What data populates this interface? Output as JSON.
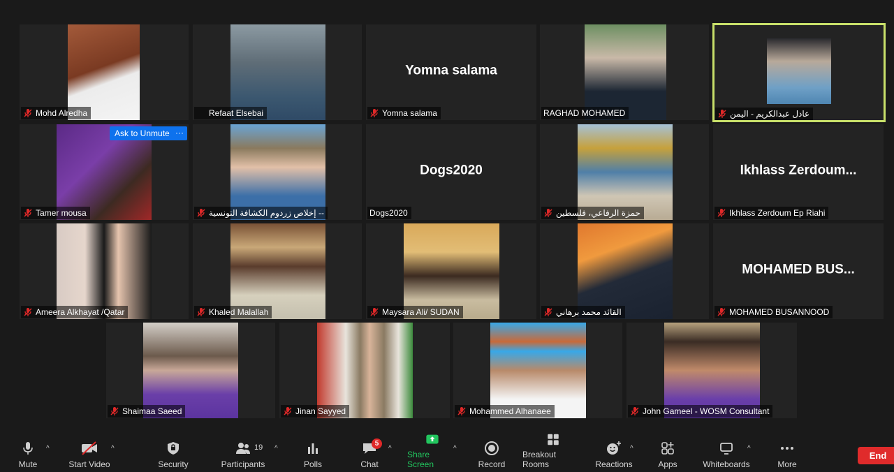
{
  "participants": [
    {
      "name": "Mohd Alredha",
      "bg": "#a35a3a",
      "fg": "#f0f0f0"
    },
    {
      "name": "Refaat Elsebai",
      "bg": "#6f7d86",
      "fg": "#3c5870"
    },
    {
      "name": "Yomna salama",
      "display": "Yomna salama"
    },
    {
      "name": "RAGHAD MOHAMED",
      "bg": "#6d8f62",
      "fg": "#1c2633"
    },
    {
      "name": "عادل عبدالكريم - اليمن",
      "bg": "#2a2a2e",
      "fg": "#6fa0c6"
    },
    {
      "name": "Tamer mousa",
      "bg": "#5b2a86",
      "fg": "#3d2a22"
    },
    {
      "name": "إخلاص زردوم الكشافة التونسية --",
      "bg": "#6aa4d4",
      "fg": "#3c6fa8"
    },
    {
      "name": "Dogs2020",
      "display": "Dogs2020"
    },
    {
      "name": "حمزة الرفاعي، فلسطين",
      "bg": "#a6c1d6",
      "fg": "#c6a13c"
    },
    {
      "name": "Ikhlass Zerdoum Ep Riahi",
      "display": "Ikhlass  Zerdoum..."
    },
    {
      "name": "Ameera Alkhayat /Qatar",
      "bg": "#d8cbc4",
      "fg": "#1a1a1a"
    },
    {
      "name": "Khaled Malallah",
      "bg": "#7a5236",
      "fg": "#d6d0bd"
    },
    {
      "name": "Maysara Ali/ SUDAN",
      "bg": "#d9a95a",
      "fg": "#3b2a20"
    },
    {
      "name": "القائد محمد برهاني",
      "bg": "#e0782e",
      "fg": "#222a38"
    },
    {
      "name": "MOHAMED BUSANNOOD",
      "display": "MOHAMED  BUS..."
    },
    {
      "name": "Shaimaa Saeed",
      "bg": "#d4cfc8",
      "fg": "#6a3fa8"
    },
    {
      "name": "Jinan Sayyed",
      "bg": "#c23a2e",
      "fg": "#8a7a62"
    },
    {
      "name": "Mohammed Alhanaee",
      "bg": "#38a8e8",
      "fg": "#f4f4f4"
    },
    {
      "name": "John Gameel - WOSM Consultant",
      "bg": "#b7a27e",
      "fg": "#6a3faa"
    }
  ],
  "hover": {
    "ask_unmute": "Ask to Unmute",
    "more": "···"
  },
  "toolbar": {
    "mute": "Mute",
    "start_video": "Start Video",
    "security": "Security",
    "participants": "Participants",
    "participants_count": "19",
    "polls": "Polls",
    "chat": "Chat",
    "chat_badge": "5",
    "share_screen": "Share Screen",
    "record": "Record",
    "breakout_rooms": "Breakout Rooms",
    "reactions": "Reactions",
    "apps": "Apps",
    "whiteboards": "Whiteboards",
    "more": "More",
    "end": "End",
    "caret": "^"
  },
  "colors": {
    "accent_active": "#c8e06a",
    "share_green": "#22c55e",
    "end_red": "#e02b2b",
    "unmute_blue": "#0e72ed"
  }
}
